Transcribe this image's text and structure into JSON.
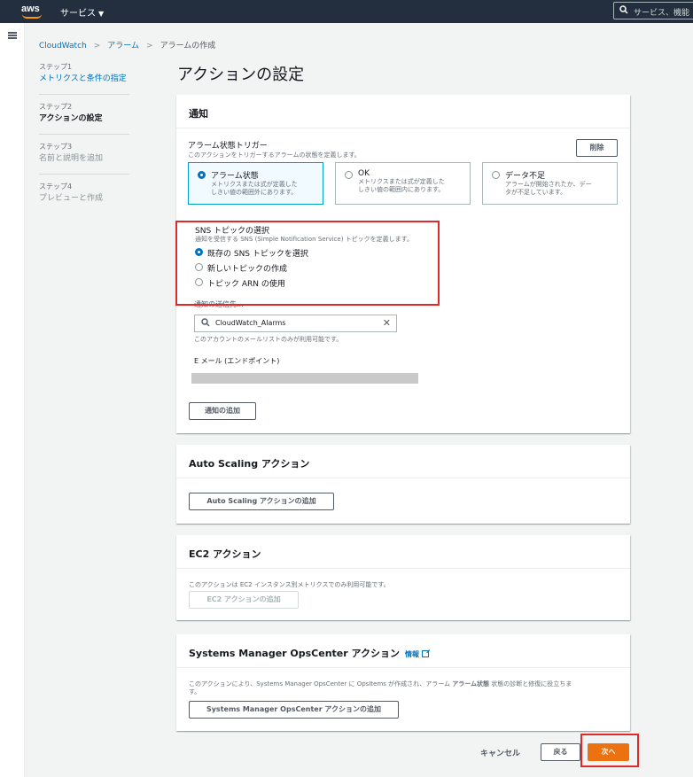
{
  "topbar": {
    "services": "サービス",
    "search_placeholder": "サービス、機能"
  },
  "breadcrumb": [
    "CloudWatch",
    "アラーム",
    "アラームの作成"
  ],
  "steps": [
    {
      "num": "ステップ1",
      "title": "メトリクスと条件の指定"
    },
    {
      "num": "ステップ2",
      "title": "アクションの設定"
    },
    {
      "num": "ステップ3",
      "title": "名前と説明を追加"
    },
    {
      "num": "ステップ4",
      "title": "プレビューと作成"
    }
  ],
  "page_title": "アクションの設定",
  "notification": {
    "heading": "通知",
    "trigger_label": "アラーム状態トリガー",
    "trigger_desc": "このアクションをトリガーするアラームの状態を定義します。",
    "remove": "削除",
    "states": [
      {
        "label": "アラーム状態",
        "desc1": "メトリクスまたは式が定義した",
        "desc2": "しきい値の範囲外にあります。"
      },
      {
        "label": "OK",
        "desc1": "メトリクスまたは式が定義した",
        "desc2": "しきい値の範囲内にあります。"
      },
      {
        "label": "データ不足",
        "desc1": "アラームが開始されたか、デー",
        "desc2": "タが不足しています。"
      }
    ],
    "sns_label": "SNS トピックの選択",
    "sns_desc": "通知を受信する SNS (Simple Notification Service) トピックを定義します。",
    "sns_options": [
      "既存の SNS トピックを選択",
      "新しいトピックの作成",
      "トピック ARN の使用"
    ],
    "send_to_label": "通知の送信先...",
    "topic_value": "CloudWatch_Alarms",
    "topic_help": "このアカウントのメールリストのみが利用可能です。",
    "email_label": "E メール (エンドポイント)",
    "add_notification": "通知の追加"
  },
  "autoscaling": {
    "heading": "Auto Scaling アクション",
    "add": "Auto Scaling アクションの追加"
  },
  "ec2": {
    "heading": "EC2 アクション",
    "desc": "このアクションは EC2 インスタンス別メトリクスでのみ利用可能です。",
    "add": "EC2 アクションの追加"
  },
  "opscenter": {
    "heading": "Systems Manager OpsCenter アクション",
    "info": "情報",
    "desc_a": "このアクションにより、Systems Manager OpsCenter に OpsItems が作成され、アラーム ",
    "desc_b": "アラーム状態",
    "desc_c": " 状態の診断と修復に役立ちま",
    "desc_d": "す。",
    "add": "Systems Manager OpsCenter アクションの追加"
  },
  "footer": {
    "cancel": "キャンセル",
    "back": "戻る",
    "next": "次へ"
  },
  "colors": {
    "primary": "#ec7211",
    "link": "#0073bb",
    "highlight": "#e02a2a"
  }
}
